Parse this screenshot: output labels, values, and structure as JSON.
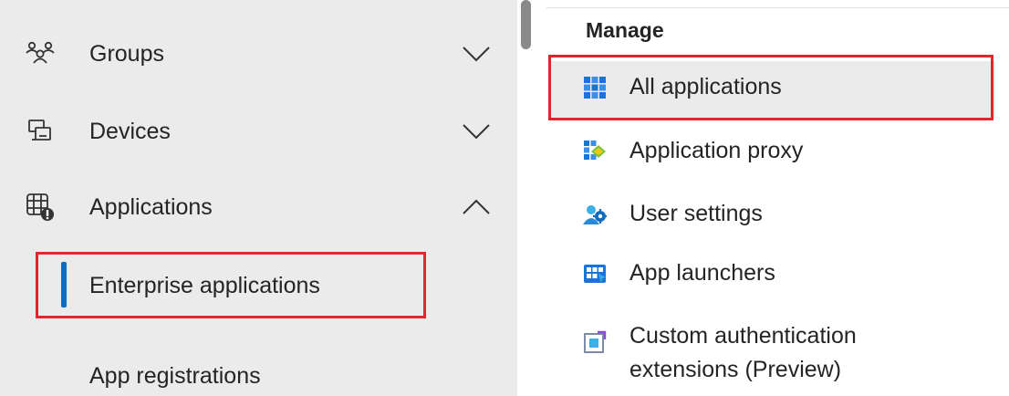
{
  "left_nav": {
    "items": [
      {
        "label": "Groups",
        "icon": "groups-icon",
        "expanded": false
      },
      {
        "label": "Devices",
        "icon": "devices-icon",
        "expanded": false
      },
      {
        "label": "Applications",
        "icon": "applications-icon",
        "expanded": true
      }
    ],
    "sub_items": [
      {
        "label": "Enterprise applications",
        "selected": true
      },
      {
        "label": "App registrations",
        "selected": false
      }
    ]
  },
  "manage": {
    "title": "Manage",
    "items": [
      {
        "label": "All applications",
        "icon": "all-applications-icon",
        "selected": true
      },
      {
        "label": "Application proxy",
        "icon": "application-proxy-icon",
        "selected": false
      },
      {
        "label": "User settings",
        "icon": "user-settings-icon",
        "selected": false
      },
      {
        "label": "App launchers",
        "icon": "app-launchers-icon",
        "selected": false
      },
      {
        "label_line1": "Custom authentication",
        "label_line2": "extensions (Preview)",
        "icon": "custom-auth-extensions-icon",
        "selected": false
      }
    ]
  },
  "colors": {
    "highlight_border": "#e3262e",
    "selection_bar": "#0f6cbd",
    "nav_background": "#ebebeb"
  }
}
